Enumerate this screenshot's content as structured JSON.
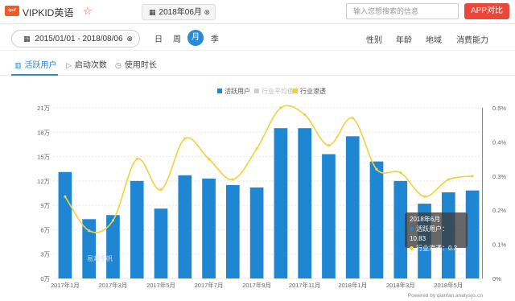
{
  "header": {
    "logo_text": "ipuf",
    "app_name": "VIPKID英语",
    "month": "2018年06月",
    "search_placeholder": "输入您想搜索的信息",
    "compare_label": "APP对比"
  },
  "filters": {
    "date_range": "2015/01/01 - 2018/08/06",
    "granularity": [
      "日",
      "周",
      "月",
      "季"
    ],
    "granularity_selected": "月",
    "dimensions": [
      "性别",
      "年龄",
      "地域",
      "消费能力"
    ]
  },
  "tabs": [
    {
      "label": "活跃用户",
      "icon": "chart-icon",
      "active": true
    },
    {
      "label": "启动次数",
      "icon": "play-icon",
      "active": false
    },
    {
      "label": "使用时长",
      "icon": "clock-icon",
      "active": false
    }
  ],
  "legend": [
    {
      "label": "活跃用户",
      "color": "#1f86d3"
    },
    {
      "label": "行业平均值",
      "color": "#cfcfcf"
    },
    {
      "label": "行业渗透",
      "color": "#f5cf3c"
    }
  ],
  "chart_data": {
    "type": "bar",
    "categories": [
      "2017年1月",
      "2017年2月",
      "2017年3月",
      "2017年4月",
      "2017年5月",
      "2017年6月",
      "2017年7月",
      "2017年8月",
      "2017年9月",
      "2017年10月",
      "2017年11月",
      "2017年12月",
      "2018年1月",
      "2018年2月",
      "2018年3月",
      "2018年4月",
      "2018年5月",
      "2018年6月"
    ],
    "x_tick_labels": [
      "2017年1月",
      "2017年3月",
      "2017年5月",
      "2017年7月",
      "2017年9月",
      "2017年11月",
      "2018年1月",
      "2018年3月",
      "2018年5月"
    ],
    "y_left_ticks": [
      "0万",
      "3万",
      "6万",
      "9万",
      "12万",
      "15万",
      "18万",
      "21万"
    ],
    "y_right_ticks": [
      "0%",
      "0.1%",
      "0.2%",
      "0.3%",
      "0.4%",
      "0.5%"
    ],
    "ylim_left": [
      0,
      21
    ],
    "ylim_right": [
      0,
      0.5
    ],
    "series": [
      {
        "name": "活跃用户",
        "axis": "left",
        "kind": "bar",
        "color": "#1f86d3",
        "values": [
          13.1,
          7.3,
          7.8,
          12.0,
          8.6,
          12.7,
          12.3,
          11.5,
          11.2,
          18.5,
          18.5,
          15.3,
          17.5,
          14.4,
          12.0,
          9.2,
          10.6,
          10.83
        ]
      },
      {
        "name": "行业渗透",
        "axis": "right",
        "kind": "line",
        "color": "#f5cf3c",
        "values": [
          0.24,
          0.14,
          0.17,
          0.35,
          0.26,
          0.41,
          0.35,
          0.29,
          0.38,
          0.5,
          0.48,
          0.39,
          0.47,
          0.32,
          0.31,
          0.24,
          0.29,
          0.3
        ]
      }
    ],
    "grid": true,
    "legend_position": "top"
  },
  "tooltip": {
    "title": "2018年6月",
    "active_label": "活跃用户：10.83",
    "penetration_label": "行业渗透：0.3"
  },
  "watermark": "易观千帆",
  "footer": "Powered by qianfan.analysys.cn"
}
